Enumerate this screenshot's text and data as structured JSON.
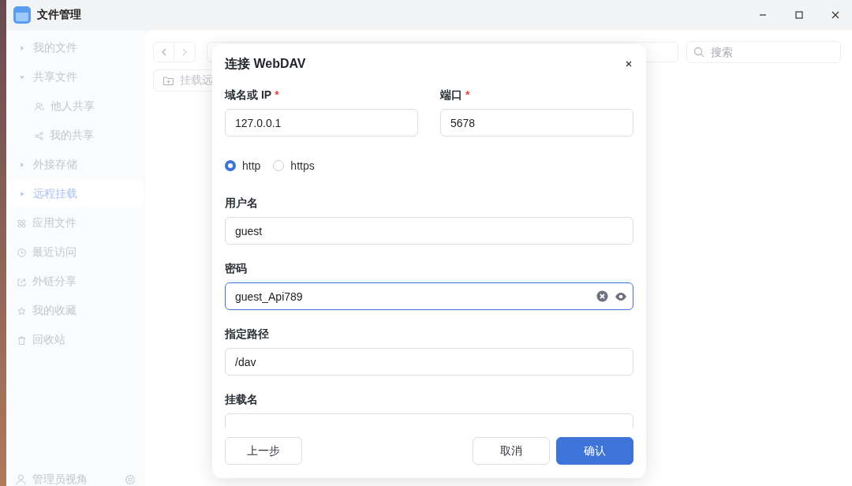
{
  "window": {
    "title": "文件管理"
  },
  "sidebar": {
    "items": [
      {
        "label": "我的文件",
        "kind": "expander",
        "expanded": false,
        "selected": false
      },
      {
        "label": "共享文件",
        "kind": "expander",
        "expanded": true,
        "selected": false,
        "children": [
          {
            "label": "他人共享",
            "kind": "people",
            "selected": false
          },
          {
            "label": "我的共享",
            "kind": "share",
            "selected": false
          }
        ]
      },
      {
        "label": "外接存储",
        "kind": "expander",
        "expanded": false,
        "selected": false
      },
      {
        "label": "远程挂载",
        "kind": "expander",
        "expanded": false,
        "selected": true
      },
      {
        "label": "应用文件",
        "kind": "apps",
        "selected": false
      },
      {
        "label": "最近访问",
        "kind": "clock",
        "selected": false
      },
      {
        "label": "外链分享",
        "kind": "export",
        "selected": false
      },
      {
        "label": "我的收藏",
        "kind": "star",
        "selected": false
      },
      {
        "label": "回收站",
        "kind": "trash",
        "selected": false
      }
    ],
    "footer": {
      "label": "管理员视角"
    }
  },
  "toolbar": {
    "search": {
      "placeholder": "搜索"
    },
    "mount_button": "挂载远"
  },
  "dialog": {
    "title": "连接 WebDAV",
    "host": {
      "label": "域名或 IP",
      "required_mark": "*",
      "value": "127.0.0.1",
      "focused": false
    },
    "port": {
      "label": "端口",
      "required_mark": "*",
      "value": "5678",
      "focused": false
    },
    "protocols": [
      {
        "label": "http",
        "selected": true
      },
      {
        "label": "https",
        "selected": false
      }
    ],
    "fields": [
      {
        "label": "用户名",
        "kind": "text",
        "value": "guest",
        "focused": false
      },
      {
        "label": "密码",
        "kind": "password",
        "value": "guest_Api789",
        "focused": true
      },
      {
        "label": "指定路径",
        "kind": "text",
        "value": "/dav",
        "focused": false
      },
      {
        "label": "挂载名",
        "kind": "text",
        "focused": false
      }
    ],
    "buttons": {
      "back": "上一步",
      "cancel": "取消",
      "confirm": "确认"
    }
  }
}
